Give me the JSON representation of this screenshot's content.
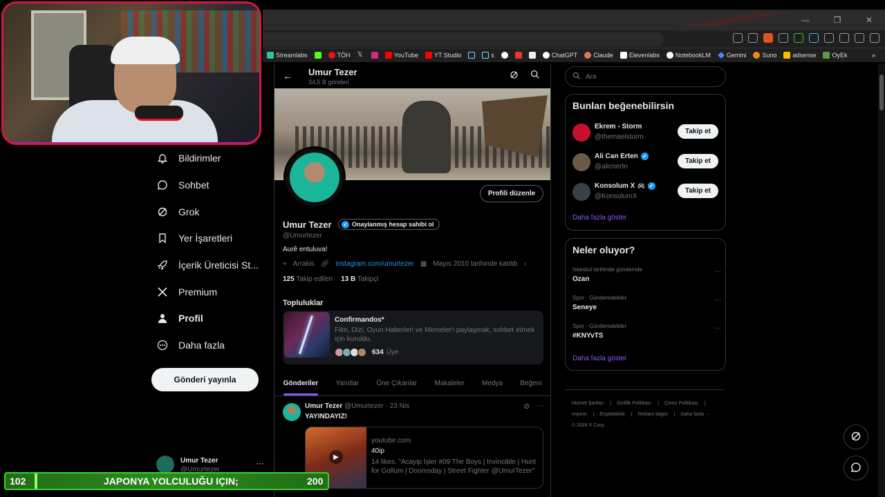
{
  "browser": {
    "bookmarks": [
      "Streamlabs",
      "",
      "TÖH",
      "",
      "",
      "YouTube",
      "YT Studio",
      "",
      "s",
      "",
      "",
      "",
      "ChatGPT",
      "Claude",
      "Elevenlabs",
      "NotebookLM",
      "Gemini",
      "Suno",
      "adsense",
      "OyEk"
    ],
    "more": "»"
  },
  "nav": {
    "items": [
      {
        "label": "Bildirimler",
        "icon": "bell-icon"
      },
      {
        "label": "Sohbet",
        "icon": "chat-icon"
      },
      {
        "label": "Grok",
        "icon": "grok-icon"
      },
      {
        "label": "Yer İşaretleri",
        "icon": "bookmark-icon"
      },
      {
        "label": "İçerik Üreticisi St...",
        "icon": "rocket-icon"
      },
      {
        "label": "Premium",
        "icon": "x-logo-icon"
      },
      {
        "label": "Profil",
        "icon": "person-icon"
      },
      {
        "label": "Daha fazla",
        "icon": "more-circle-icon"
      }
    ],
    "post_button": "Gönderi yayınla",
    "account": {
      "name": "Umur Tezer",
      "handle": "@Umurtezer",
      "more": "···"
    }
  },
  "profile": {
    "header_name": "Umur Tezer",
    "header_count": "34,5 B gönderi",
    "edit_button": "Profili düzenle",
    "name": "Umur Tezer",
    "verify_pill": "Onaylanmış hesap sahibi ol",
    "handle": "@Umurtezer",
    "bio": "Aurê entuluva!",
    "location": "Arrakis",
    "link": "instagram.com/umurtezer",
    "joined": "Mayıs 2010 tarihinde katıldı",
    "following_count": "125",
    "following_label": "Takip edilen",
    "followers_count": "13 B",
    "followers_label": "Takipçi"
  },
  "communities": {
    "title": "Topluluklar",
    "name": "Confirmandos*",
    "desc": "Film, Dizi, Oyun Haberleri ve Memeler'i paylaşmak, sohbet etmek için kuruldu.",
    "members": "634",
    "members_label": "Üye"
  },
  "tabs": [
    "Gönderiler",
    "Yanıtlar",
    "Öne Çıkanlar",
    "Makaleler",
    "Medya",
    "Beğeni"
  ],
  "tweet": {
    "name": "Umur Tezer",
    "handle": "@Umurtezer",
    "date": "· 23 Nis",
    "text": "YAYINDAYIZ!",
    "card_domain": "youtube.com",
    "card_title": "40ip",
    "card_desc": "14 likes. \"Acayip İşler #09 The Boys | Invincible | Hunt for Gollum | Doomsday | Street Fighter @UmurTezer\""
  },
  "right": {
    "search_placeholder": "Ara",
    "wtf_title": "Bunları beğenebilirsin",
    "wtf": [
      {
        "name": "Ekrem - Storm",
        "handle": "@themaelstorm",
        "verified": false,
        "color": "#c8102e"
      },
      {
        "name": "Ali Can Erten",
        "handle": "@alicnertn",
        "verified": true,
        "color": "#6b5a4a"
      },
      {
        "name": "Konsolum X",
        "handle": "@KonsolumX",
        "verified": true,
        "color": "#3a4048"
      }
    ],
    "follow_label": "Takip et",
    "show_more": "Daha fazla göster",
    "trends_title": "Neler oluyor?",
    "trends": [
      {
        "context": "İstanbul tarihinde gündemde",
        "topic": "Ozan"
      },
      {
        "context": "Spor · Gündemdekiler",
        "topic": "Seneye"
      },
      {
        "context": "Spor · Gündemdekiler",
        "topic": "#KNYvTS"
      }
    ],
    "footer": [
      "Hizmet Şartları",
      "Gizlilik Politikası",
      "Çerez Politikası",
      "Imprint",
      "Erişilebilirlik",
      "Reklam bilgisi",
      "Daha fazla ···",
      "© 2026 X Corp."
    ]
  },
  "ticker": {
    "left": "102",
    "text": "JAPONYA YOLCULUĞU IÇIN;",
    "right": "200"
  },
  "colors": {
    "accent": "#8b5cf6",
    "verified": "#1d9bf0",
    "ticker": "#2c8a1d",
    "cam_border": "#d7144d"
  }
}
